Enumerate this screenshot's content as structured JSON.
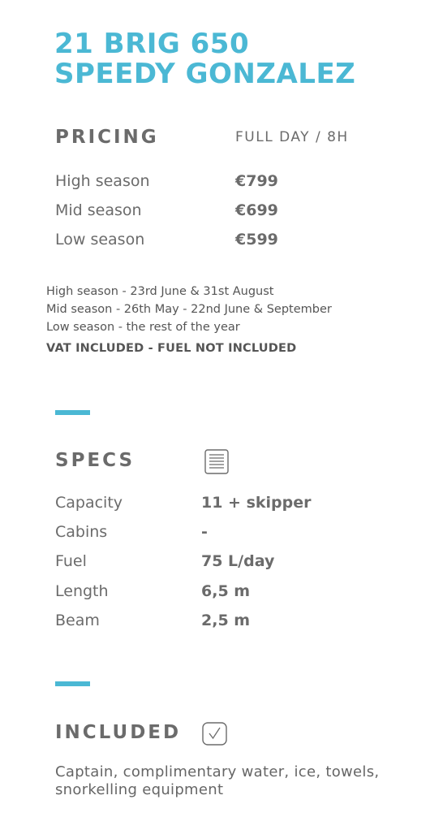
{
  "title": {
    "line1": "21 BRIG 650",
    "line2": "SPEEDY GONZALEZ"
  },
  "pricing": {
    "heading": "PRICING",
    "duration": "FULL DAY / 8H",
    "rows": [
      {
        "label": "High season",
        "price": "€799"
      },
      {
        "label": "Mid season",
        "price": "€699"
      },
      {
        "label": "Low season",
        "price": "€599"
      }
    ],
    "notes": [
      "High season - 23rd June & 31st August",
      "Mid season - 26th May - 22nd June & September",
      "Low season - the rest of the year"
    ],
    "vat_note": "VAT INCLUDED - FUEL NOT INCLUDED"
  },
  "specs": {
    "heading": "SPECS",
    "icon": "document-icon",
    "rows": [
      {
        "label": "Capacity",
        "value": "11 + skipper"
      },
      {
        "label": "Cabins",
        "value": "-"
      },
      {
        "label": "Fuel",
        "value": "75 L/day"
      },
      {
        "label": "Length",
        "value": "6,5 m"
      },
      {
        "label": "Beam",
        "value": "2,5 m"
      }
    ]
  },
  "included": {
    "heading": "INCLUDED",
    "icon": "checkbox-icon",
    "text": "Captain, complimentary water, ice, towels, snorkelling equipment"
  },
  "colors": {
    "accent": "#4bb8d4",
    "text": "#6b6b6b"
  }
}
